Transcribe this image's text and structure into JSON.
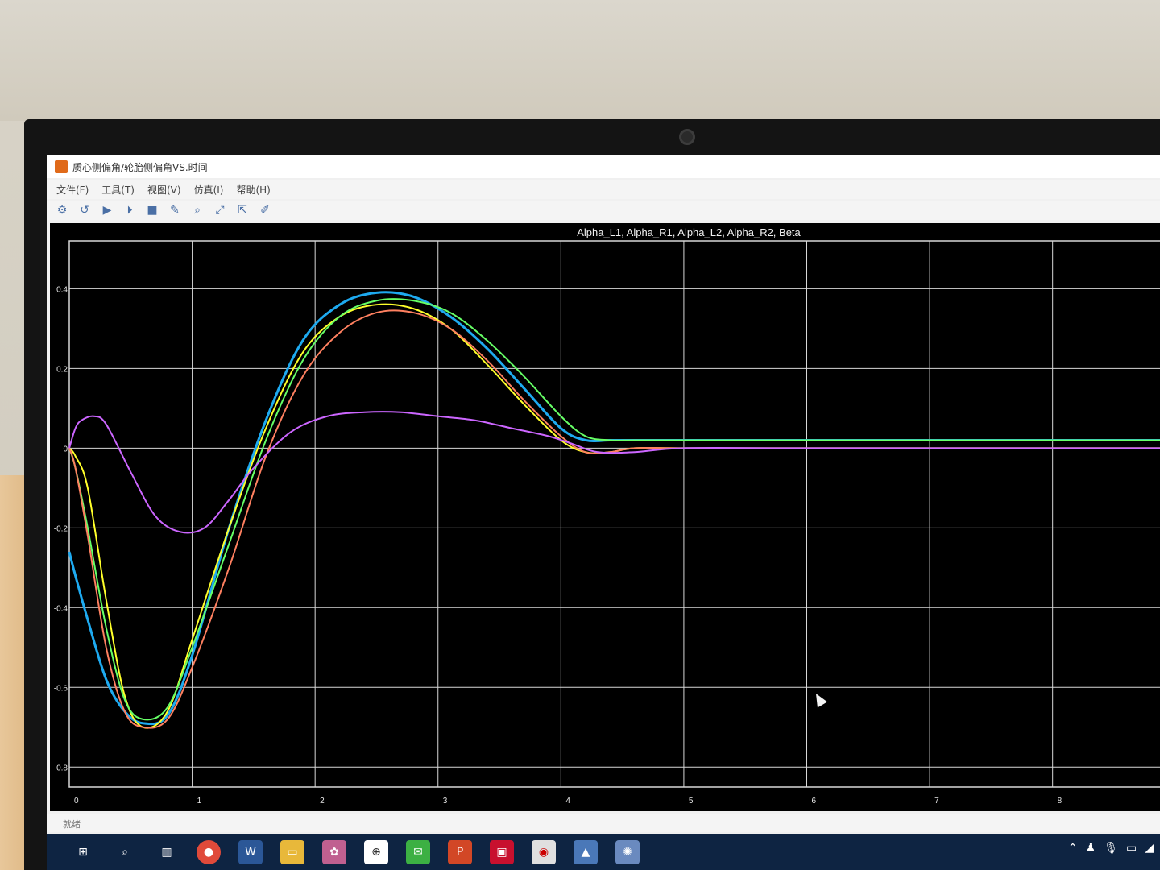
{
  "window": {
    "title": "质心侧偏角/轮胎侧偏角VS.时间"
  },
  "menu": {
    "items": [
      "文件(F)",
      "工具(T)",
      "视图(V)",
      "仿真(I)",
      "帮助(H)"
    ]
  },
  "status": {
    "text": "就绪"
  },
  "icons": {
    "app": "scope-app-icon",
    "toolbar": [
      "settings-icon",
      "step-back-icon",
      "run-icon",
      "step-forward-icon",
      "stop-icon",
      "highlight-icon",
      "zoom-icon",
      "fit-icon",
      "cursor-measure-icon",
      "edit-icon"
    ],
    "taskbar": [
      "windows-start-icon",
      "search-icon",
      "task-view-icon",
      "chrome-icon",
      "word-icon",
      "file-explorer-icon",
      "app-icon",
      "network-icon",
      "wechat-icon",
      "powerpoint-icon",
      "reader-icon",
      "remote-icon",
      "matlab-icon",
      "gear-app-icon"
    ]
  },
  "chart_data": {
    "type": "line",
    "title": "Alpha_L1, Alpha_R1, Alpha_L2, Alpha_R2, Beta",
    "xlabel": "",
    "ylabel": "",
    "xlim": [
      0,
      8.9
    ],
    "ylim": [
      -0.85,
      0.52
    ],
    "x_ticks": [
      0,
      1,
      2,
      3,
      4,
      5,
      6,
      7,
      8
    ],
    "y_ticks": [
      0.4,
      0.2,
      0,
      -0.2,
      -0.4,
      -0.6,
      -0.8
    ],
    "grid": true,
    "background": "#000000",
    "gridcolor": "#d8d8d8",
    "textcolor": "#e6e6e6",
    "series": [
      {
        "color": "#1eaaf0",
        "x": [
          0,
          0.05,
          0.15,
          0.3,
          0.45,
          0.6,
          0.8,
          1.0,
          1.3,
          1.6,
          1.9,
          2.2,
          2.5,
          2.8,
          3.1,
          3.4,
          3.7,
          4.0,
          4.2,
          4.4,
          4.6,
          5.0,
          6.0,
          8.9
        ],
        "y": [
          -0.26,
          -0.32,
          -0.43,
          -0.58,
          -0.66,
          -0.69,
          -0.67,
          -0.52,
          -0.2,
          0.07,
          0.27,
          0.36,
          0.39,
          0.38,
          0.33,
          0.25,
          0.15,
          0.05,
          0.02,
          0.02,
          0.02,
          0.02,
          0.02,
          0.02
        ]
      },
      {
        "color": "#ffff2a",
        "x": [
          0,
          0.05,
          0.15,
          0.3,
          0.45,
          0.6,
          0.8,
          1.0,
          1.3,
          1.6,
          1.9,
          2.2,
          2.5,
          2.8,
          3.1,
          3.4,
          3.7,
          4.0,
          4.2,
          4.4,
          4.6,
          5.0,
          6.0,
          8.9
        ],
        "y": [
          0.0,
          -0.02,
          -0.1,
          -0.38,
          -0.62,
          -0.7,
          -0.66,
          -0.48,
          -0.2,
          0.05,
          0.24,
          0.33,
          0.36,
          0.35,
          0.3,
          0.21,
          0.11,
          0.02,
          -0.01,
          -0.01,
          0.0,
          0.0,
          0.0,
          0.0
        ]
      },
      {
        "color": "#66ff66",
        "x": [
          0,
          0.05,
          0.15,
          0.3,
          0.45,
          0.6,
          0.8,
          1.0,
          1.3,
          1.6,
          1.9,
          2.2,
          2.5,
          2.8,
          3.1,
          3.4,
          3.7,
          4.0,
          4.2,
          4.4,
          4.6,
          5.0,
          6.0,
          8.9
        ],
        "y": [
          0.0,
          -0.05,
          -0.2,
          -0.45,
          -0.63,
          -0.68,
          -0.65,
          -0.5,
          -0.24,
          0.02,
          0.22,
          0.33,
          0.37,
          0.37,
          0.34,
          0.27,
          0.18,
          0.08,
          0.03,
          0.02,
          0.02,
          0.02,
          0.02,
          0.02
        ]
      },
      {
        "color": "#ff8060",
        "x": [
          0,
          0.05,
          0.15,
          0.3,
          0.45,
          0.6,
          0.8,
          1.0,
          1.3,
          1.6,
          1.9,
          2.2,
          2.5,
          2.8,
          3.1,
          3.4,
          3.7,
          4.0,
          4.2,
          4.4,
          4.6,
          5.0,
          6.0,
          8.9
        ],
        "y": [
          0.0,
          -0.05,
          -0.22,
          -0.5,
          -0.66,
          -0.7,
          -0.68,
          -0.55,
          -0.3,
          -0.02,
          0.18,
          0.29,
          0.34,
          0.34,
          0.3,
          0.22,
          0.12,
          0.03,
          -0.01,
          -0.01,
          0.0,
          0.0,
          0.0,
          0.0
        ]
      },
      {
        "color": "#cc66ff",
        "x": [
          0,
          0.05,
          0.1,
          0.2,
          0.3,
          0.5,
          0.7,
          0.9,
          1.1,
          1.3,
          1.5,
          1.8,
          2.1,
          2.4,
          2.7,
          3.0,
          3.3,
          3.6,
          3.9,
          4.1,
          4.3,
          4.6,
          5.0,
          6.0,
          8.9
        ],
        "y": [
          0.0,
          0.05,
          0.07,
          0.08,
          0.06,
          -0.06,
          -0.17,
          -0.21,
          -0.2,
          -0.13,
          -0.05,
          0.04,
          0.08,
          0.09,
          0.09,
          0.08,
          0.07,
          0.05,
          0.03,
          0.01,
          -0.01,
          -0.01,
          0.0,
          0.0,
          0.0
        ]
      }
    ]
  }
}
